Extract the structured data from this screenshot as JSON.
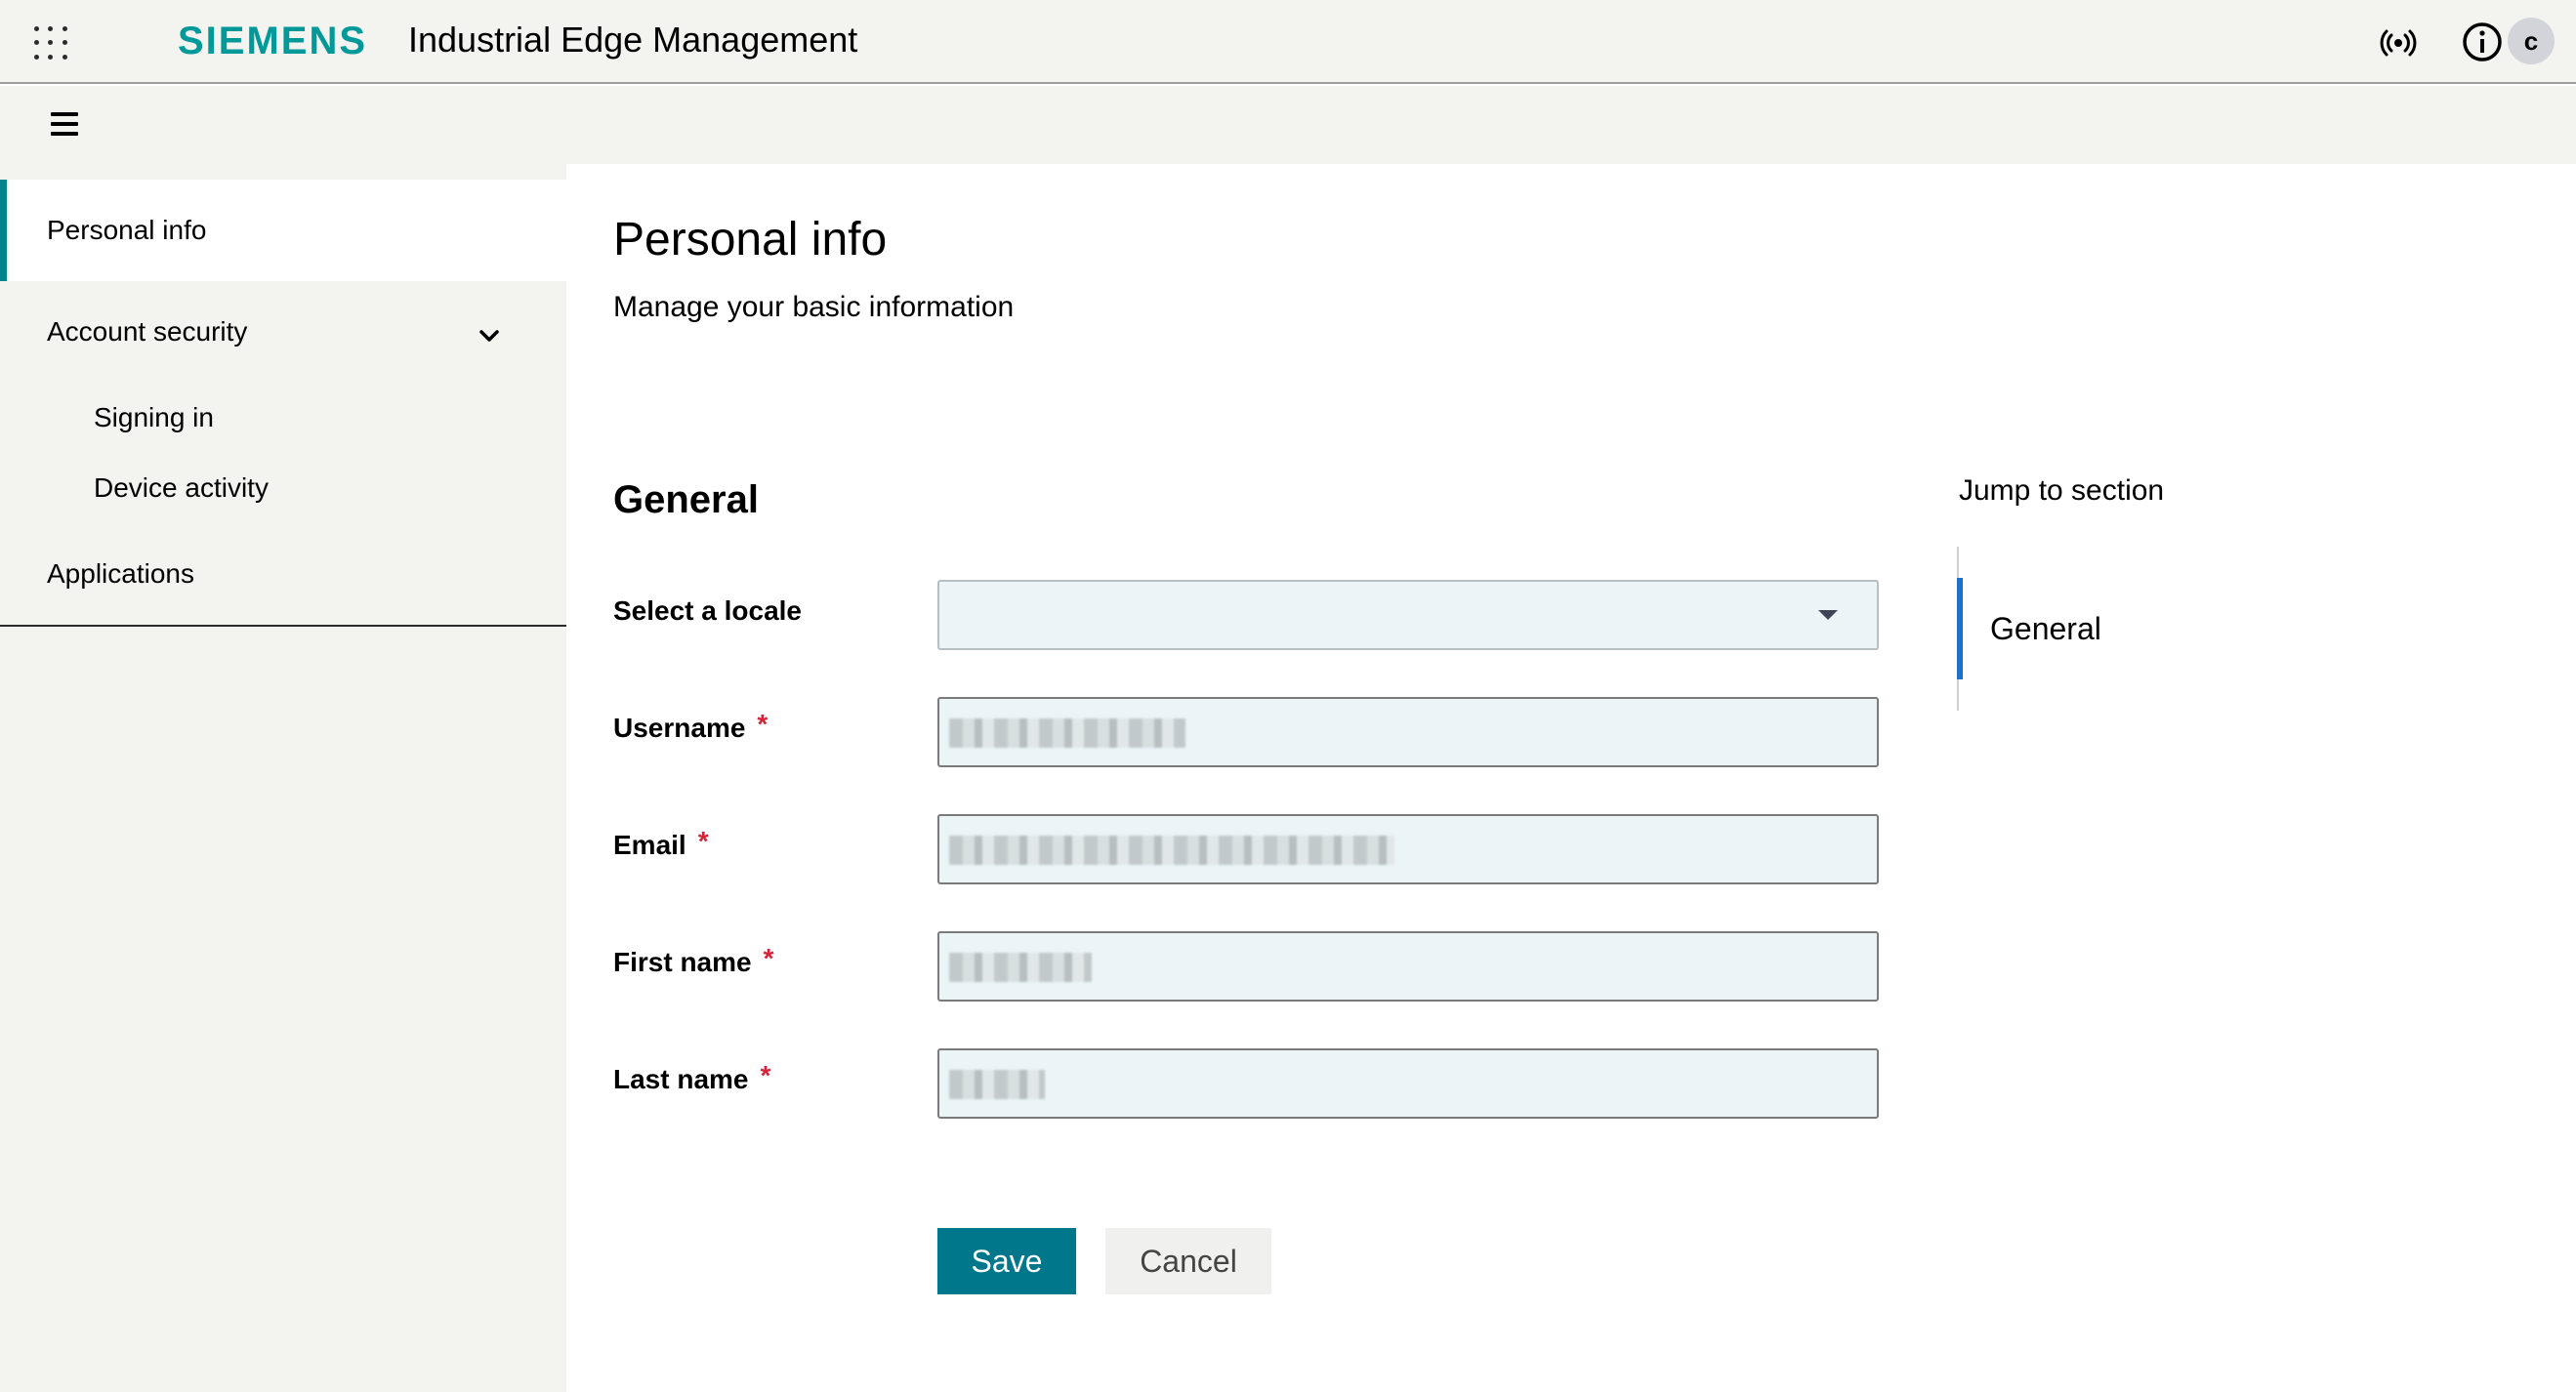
{
  "topbar": {
    "brand": "SIEMENS",
    "app_title": "Industrial Edge Management",
    "avatar_initial": "c",
    "icons": [
      "apps-grid-icon",
      "signal-icon",
      "info-icon"
    ]
  },
  "sidebar": {
    "items": [
      {
        "label": "Personal info",
        "active": true
      },
      {
        "label": "Account security",
        "expanded": true,
        "children": [
          {
            "label": "Signing in"
          },
          {
            "label": "Device activity"
          }
        ]
      },
      {
        "label": "Applications"
      }
    ]
  },
  "main": {
    "title": "Personal info",
    "subtitle": "Manage your basic information",
    "section_title": "General",
    "fields": {
      "locale": {
        "label": "Select a locale",
        "value": ""
      },
      "username": {
        "label": "Username",
        "required_mark": "*"
      },
      "email": {
        "label": "Email",
        "required_mark": "*"
      },
      "first_name": {
        "label": "First name",
        "required_mark": "*"
      },
      "last_name": {
        "label": "Last name",
        "required_mark": "*"
      }
    },
    "save_label": "Save",
    "cancel_label": "Cancel"
  },
  "jump": {
    "title": "Jump to section",
    "items": [
      {
        "label": "General"
      }
    ]
  },
  "colors": {
    "brand": "#009999",
    "accent": "#00778a",
    "jump_marker": "#1f6fd0",
    "required": "#d72339"
  }
}
